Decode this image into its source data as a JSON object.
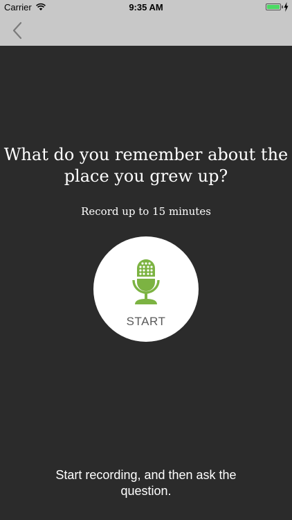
{
  "status_bar": {
    "carrier": "Carrier",
    "time": "9:35 AM",
    "icons": [
      "wifi-icon",
      "battery-icon",
      "charging-icon"
    ]
  },
  "nav_bar": {
    "back_icon": "chevron-left-icon"
  },
  "prompt": {
    "question": "What do you remember about the place you grew up?",
    "subtitle": "Record up to 15 minutes"
  },
  "record_button": {
    "label": "START",
    "icon": "microphone-icon",
    "accent_color": "#7cb342"
  },
  "footer": {
    "instruction": "Start recording, and then ask the question."
  },
  "colors": {
    "background": "#2b2b2b",
    "bars": "#c8c8c8",
    "accent": "#7cb342",
    "button": "#ffffff"
  }
}
